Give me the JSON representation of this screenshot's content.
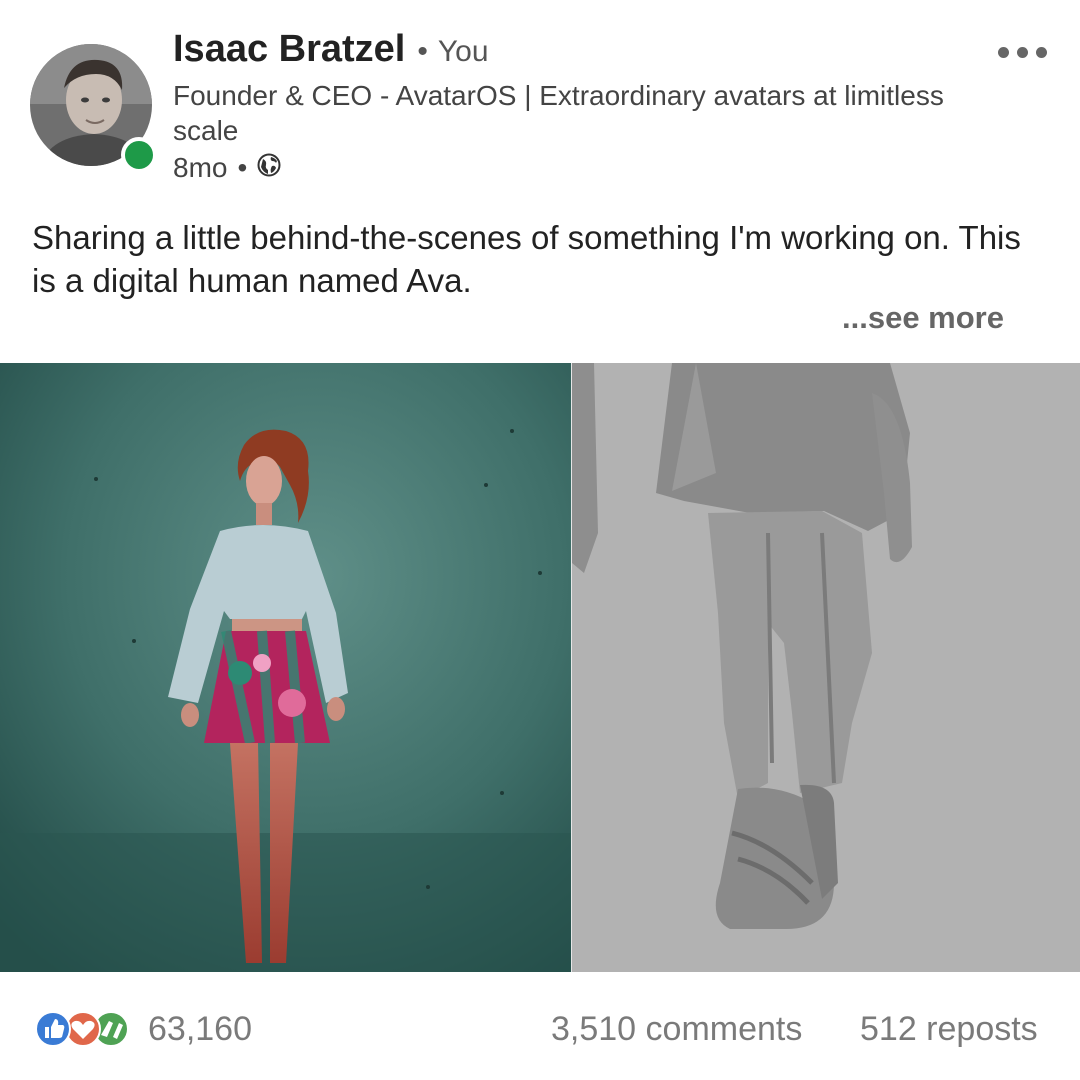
{
  "post": {
    "author": {
      "name": "Isaac Bratzel",
      "relation": "You",
      "headline": "Founder & CEO - AvatarOS | Extraordinary avatars at limitless scale",
      "time": "8mo",
      "online": true
    },
    "text": "Sharing a little behind-the-scenes of something I'm working on. This is a digital human named Ava.",
    "see_more_label": "...see more",
    "menu_icon": "more-icon",
    "visibility_icon": "globe-icon",
    "media": {
      "left": "rendered-avatar-photo",
      "right": "grey-3d-mesh-render"
    },
    "social": {
      "reaction_icons": [
        "like-icon",
        "love-icon",
        "celebrate-icon"
      ],
      "reactions": "63,160",
      "comments": "3,510 comments",
      "reposts": "512 reposts"
    }
  },
  "colors": {
    "presence": "#1e9a48",
    "like": "#3a7bd5",
    "love": "#e0674a",
    "celebrate": "#4fa254"
  }
}
